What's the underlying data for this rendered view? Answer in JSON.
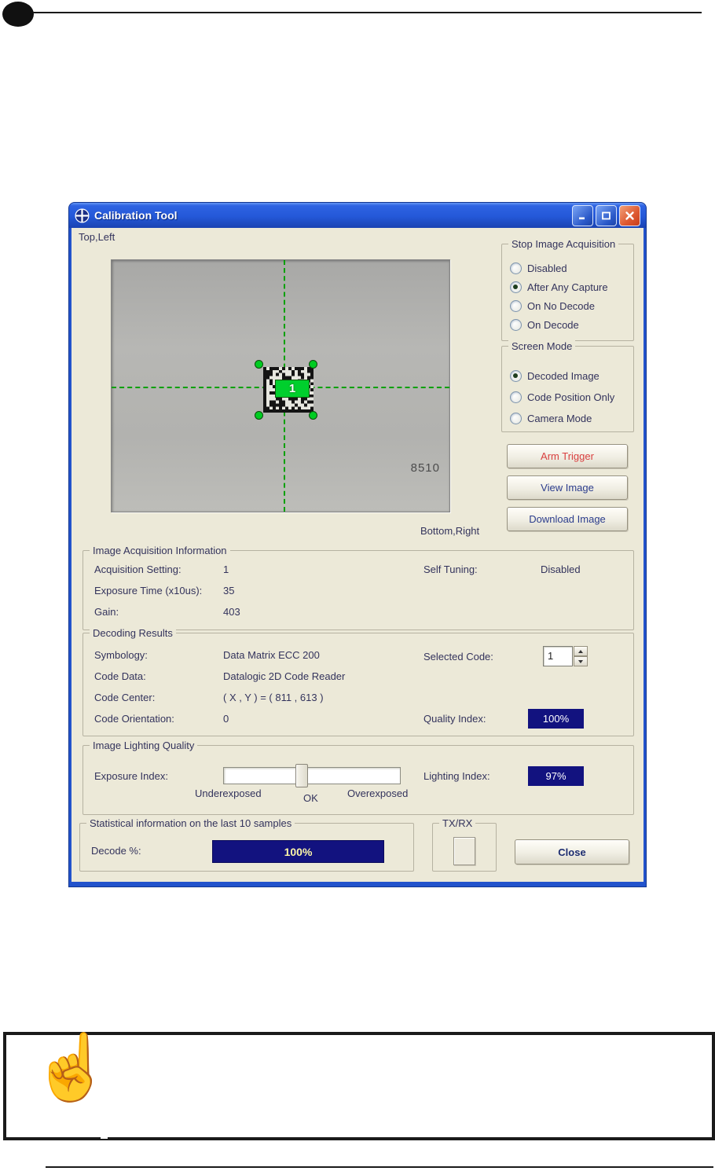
{
  "colors": {
    "titlebar-blue": "#2a5ade",
    "window-border": "#2253cc",
    "client-bg": "#ece9d8",
    "navy": "#12127f",
    "decode-bar-text": "#fdf6a8",
    "arm-red": "#d94040",
    "button-navy": "#2b3c8c",
    "label": "#33335c",
    "green": "#00cf2d",
    "crosshair-green": "#00a000"
  },
  "window": {
    "title": "Calibration Tool",
    "top_left_label": "Top,Left",
    "bottom_right_label": "Bottom,Right",
    "image_view": {
      "code_label": "1",
      "tag": "8510"
    },
    "stop_image_acquisition": {
      "caption": "Stop Image Acquisition",
      "options": [
        {
          "label": "Disabled",
          "selected": false
        },
        {
          "label": "After Any Capture",
          "selected": true
        },
        {
          "label": "On No Decode",
          "selected": false
        },
        {
          "label": "On Decode",
          "selected": false
        }
      ]
    },
    "screen_mode": {
      "caption": "Screen Mode",
      "options": [
        {
          "label": "Decoded Image",
          "selected": true
        },
        {
          "label": "Code Position Only",
          "selected": false
        },
        {
          "label": "Camera Mode",
          "selected": false
        }
      ]
    },
    "action_buttons": {
      "arm_trigger": "Arm Trigger",
      "view_image": "View Image",
      "download_image": "Download Image",
      "close": "Close"
    },
    "image_acquisition_information": {
      "caption": "Image Acquisition Information",
      "rows": [
        {
          "label": "Acquisition Setting:",
          "value": "1"
        },
        {
          "label": "Exposure Time (x10us):",
          "value": "35"
        },
        {
          "label": "Gain:",
          "value": "403"
        }
      ],
      "right_rows": [
        {
          "label": "Self Tuning:",
          "value": "Disabled"
        }
      ]
    },
    "decoding_results": {
      "caption": "Decoding Results",
      "rows": [
        {
          "label": "Symbology:",
          "value": "Data Matrix ECC 200"
        },
        {
          "label": "Code Data:",
          "value": "Datalogic 2D Code Reader"
        },
        {
          "label": "Code Center:",
          "value": "( X , Y ) = ( 811 , 613 )"
        },
        {
          "label": "Code Orientation:",
          "value": "0"
        }
      ],
      "selected_code": {
        "label": "Selected Code:",
        "value": "1"
      },
      "quality_index": {
        "label": "Quality Index:",
        "value": "100%"
      }
    },
    "image_lighting_quality": {
      "caption": "Image Lighting Quality",
      "exposure_label": "Exposure Index:",
      "slider": {
        "thumb_pct": 44,
        "left_label": "Underexposed",
        "mid_label": "OK",
        "right_label": "Overexposed"
      },
      "lighting_index": {
        "label": "Lighting Index:",
        "value": "97%"
      }
    },
    "statistics": {
      "caption": "Statistical information on the last 10 samples",
      "decode_label": "Decode %:",
      "decode_value": "100%"
    },
    "txrx": {
      "caption": "TX/RX"
    }
  }
}
